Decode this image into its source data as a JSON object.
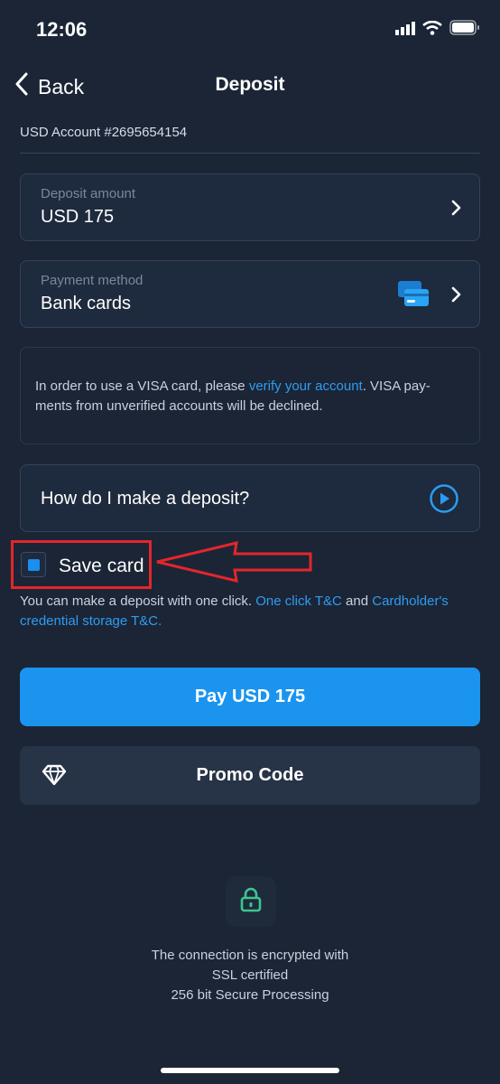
{
  "status_bar": {
    "time": "12:06"
  },
  "nav": {
    "back_label": "Back",
    "title": "Deposit"
  },
  "account": {
    "label": "USD Account #2695654154"
  },
  "deposit_amount": {
    "label": "Deposit amount",
    "value": "USD 175"
  },
  "payment_method": {
    "label": "Payment method",
    "value": "Bank cards",
    "icon": "bank-cards-icon"
  },
  "notice": {
    "text_before": "In order to use a VISA card, please ",
    "link": "verify your account",
    "text_after": ". VISA pay-ments from unverified accounts will be declined."
  },
  "howto": {
    "label": "How do I make a deposit?"
  },
  "save_card": {
    "label": "Save card",
    "checked": true,
    "help_before": "You can make a deposit with one click. ",
    "link1": "One click T&C",
    "help_middle": " and ",
    "link2": "Cardholder's credential storage T&C."
  },
  "pay_button": {
    "label": "Pay USD 175"
  },
  "promo_button": {
    "label": "Promo Code",
    "icon": "diamond-icon"
  },
  "security": {
    "line1": "The connection is encrypted with",
    "line2": "SSL certified",
    "line3": "256 bit Secure Processing"
  },
  "colors": {
    "background": "#1b2536",
    "accent": "#1a94ef",
    "link": "#2f9cf0",
    "highlight": "#e3262b"
  }
}
